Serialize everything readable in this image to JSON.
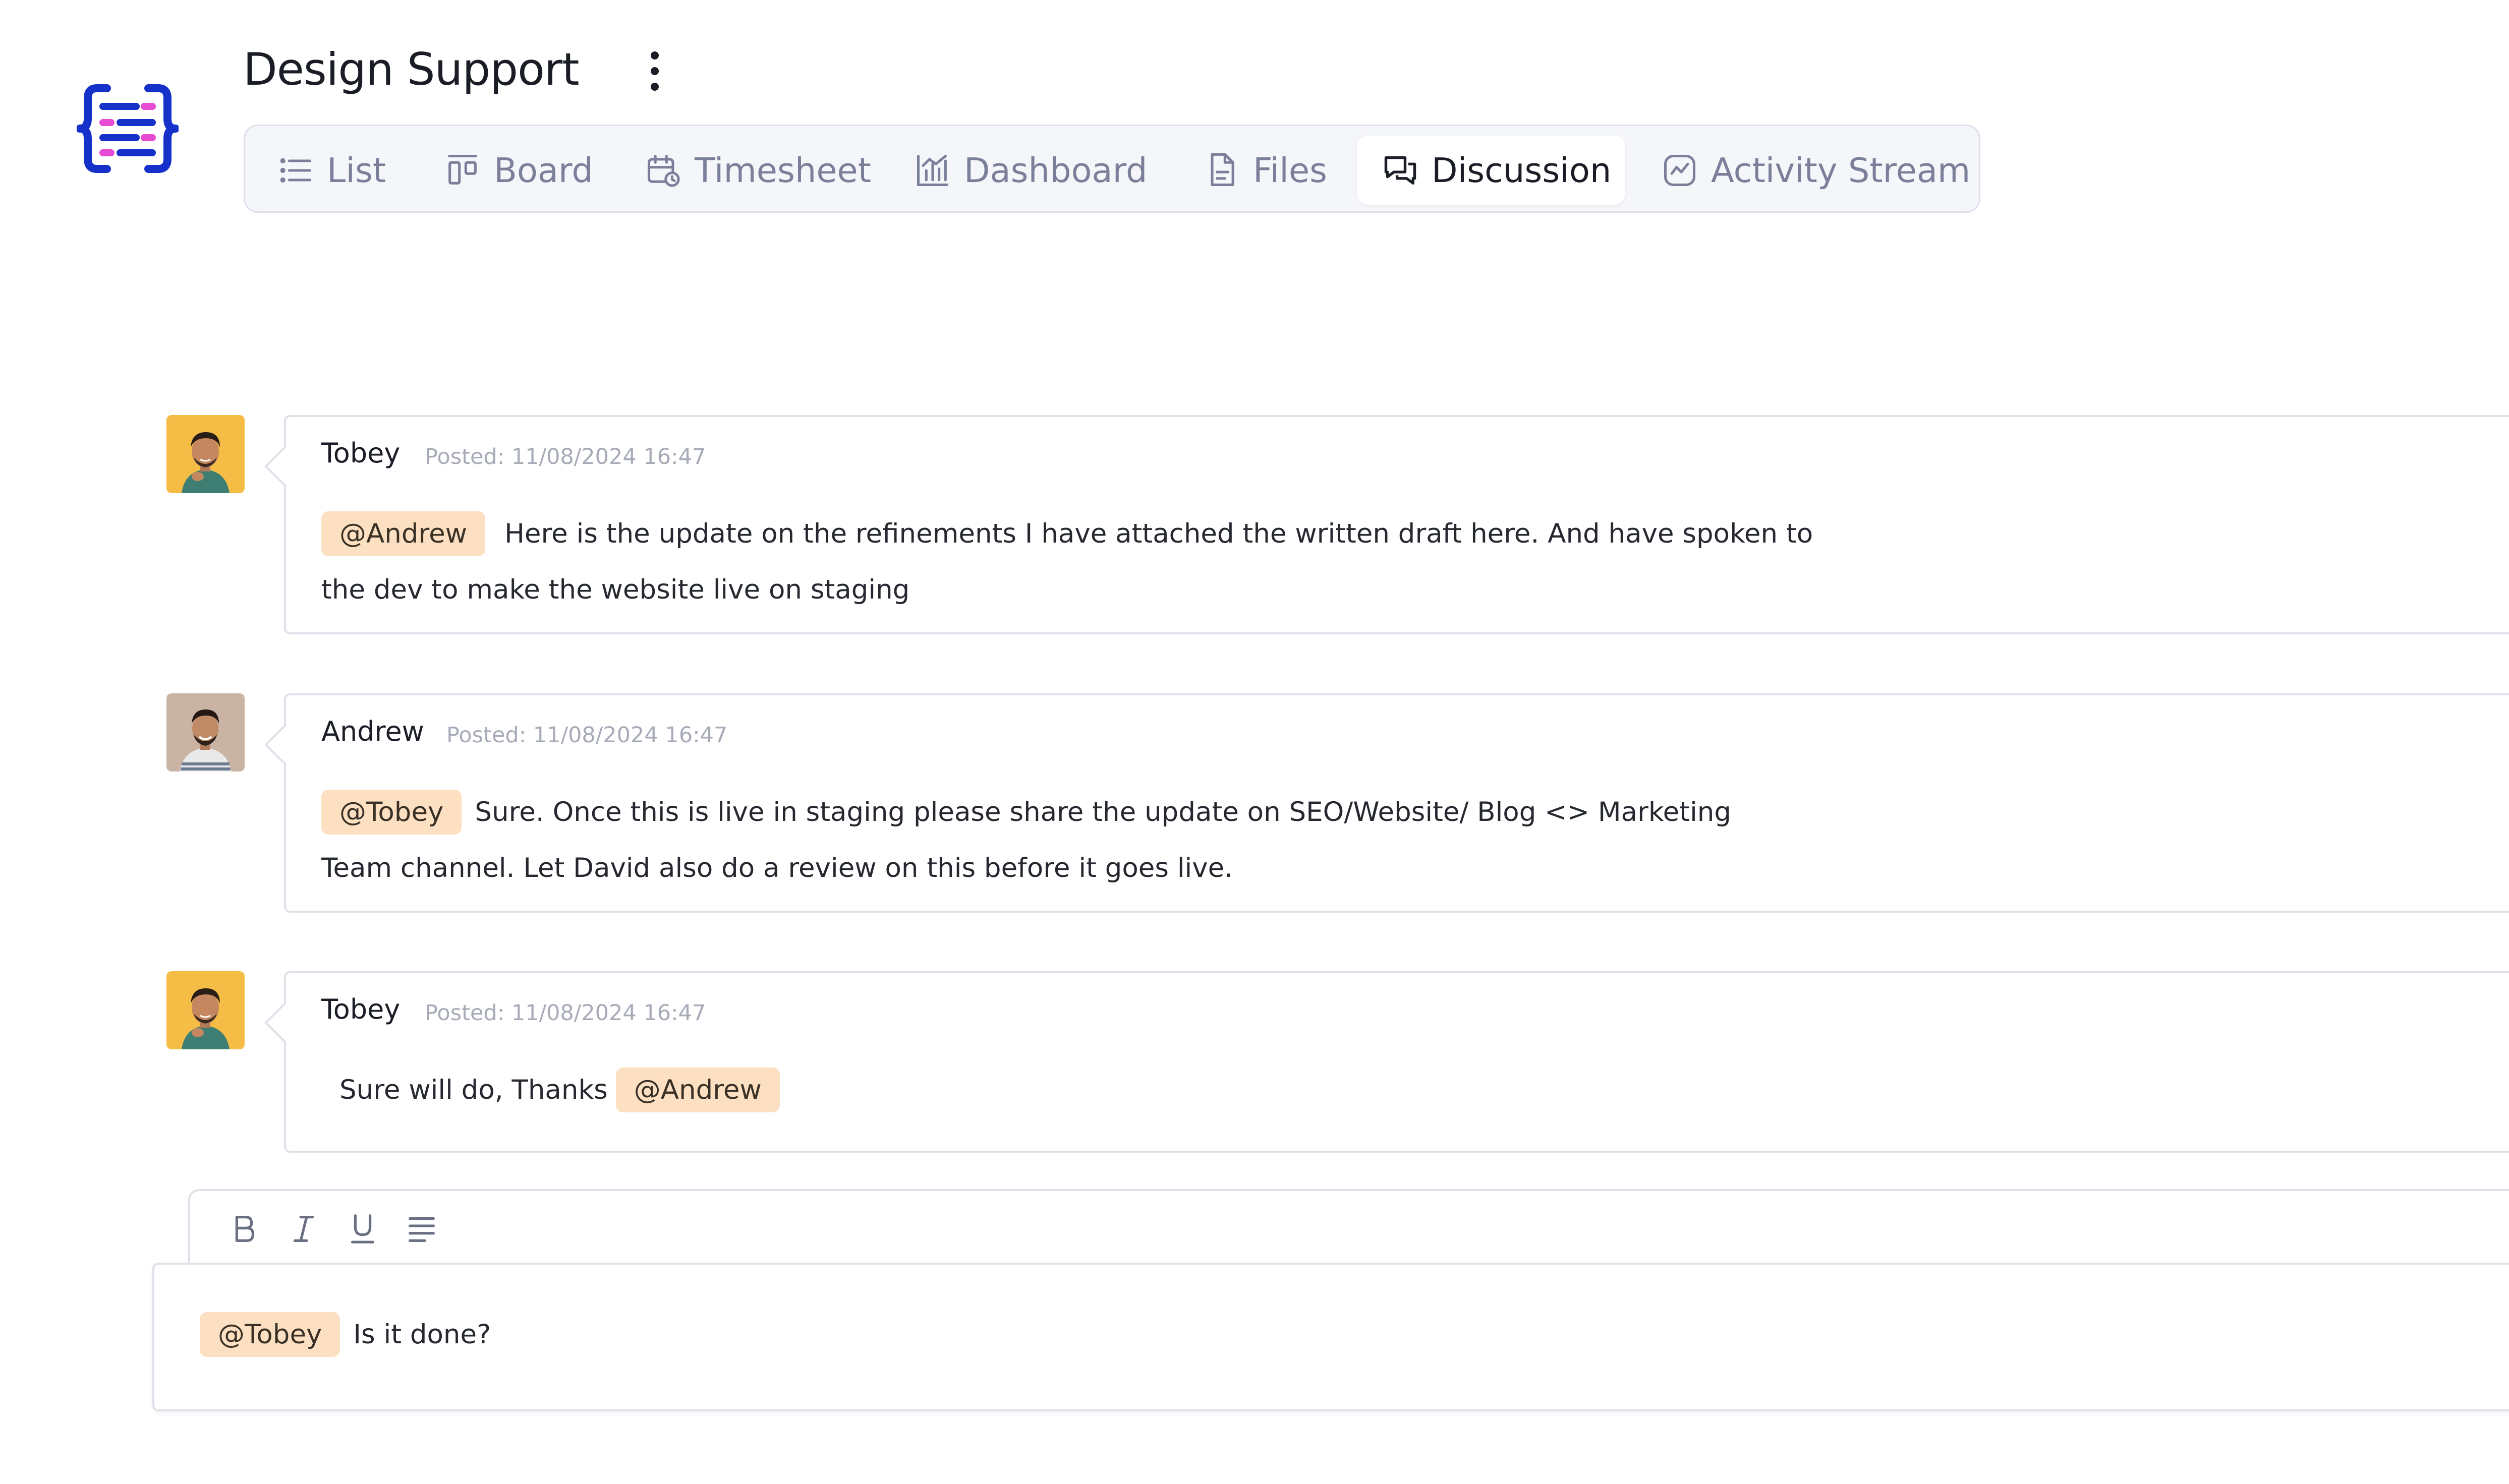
{
  "header": {
    "title": "Design Support"
  },
  "tabs": [
    {
      "label": "List",
      "icon": "list-icon"
    },
    {
      "label": "Board",
      "icon": "board-icon"
    },
    {
      "label": "Timesheet",
      "icon": "calendar-clock-icon"
    },
    {
      "label": "Dashboard",
      "icon": "bar-chart-icon"
    },
    {
      "label": "Files",
      "icon": "file-icon"
    },
    {
      "label": "Discussion",
      "icon": "chat-icon",
      "active": true
    },
    {
      "label": "Activity Stream",
      "icon": "activity-icon"
    }
  ],
  "messages": [
    {
      "author": "Tobey",
      "posted": "Posted: 11/08/2024 16:47",
      "mention": "@Andrew",
      "line1": "Here is the update on the refinements I have attached the written draft here. And have spoken to",
      "line2": "the dev to make the website live on staging"
    },
    {
      "author": "Andrew",
      "posted": "Posted: 11/08/2024 16:47",
      "mention": "@Tobey",
      "line1": "Sure. Once this is live in staging please share the update on SEO/Website/ Blog <> Marketing",
      "line2": "Team channel.  Let David also do a review on this before it goes live."
    },
    {
      "author": "Tobey",
      "posted": "Posted: 11/08/2024 16:47",
      "text": "Sure will do, Thanks",
      "mention": "@Andrew"
    }
  ],
  "composer": {
    "mention": "@Tobey",
    "text": "Is it done?",
    "toolbar": [
      "bold",
      "italic",
      "underline",
      "align"
    ]
  },
  "colors": {
    "accent": "#1631c9",
    "mention_bg": "#fde0c2",
    "border": "#dfe1e8"
  }
}
